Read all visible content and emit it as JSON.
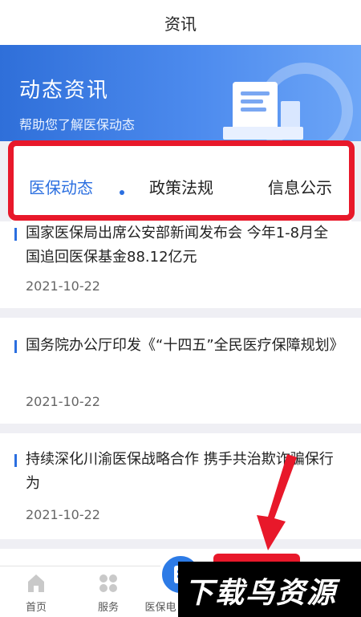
{
  "header": {
    "title": "资讯"
  },
  "hero": {
    "title": "动态资讯",
    "subtitle": "帮助您了解医保动态"
  },
  "tabs": [
    {
      "label": "医保动态",
      "active": true
    },
    {
      "label": "政策法规",
      "active": false
    },
    {
      "label": "信息公示",
      "active": false
    }
  ],
  "news": [
    {
      "headline": "国家医保局出席公安部新闻发布会 今年1-8月全国追回医保基金88.12亿元",
      "date": "2021-10-22"
    },
    {
      "headline": "国务院办公厅印发《“十四五”全民医疗保障规划》",
      "date": "2021-10-22"
    },
    {
      "headline": "持续深化川渝医保战略合作 携手共治欺诈骗保行为",
      "date": "2021-10-22"
    }
  ],
  "bottom_nav": {
    "home": "首页",
    "service": "服务",
    "third": "医保电"
  },
  "watermark": "下载鸟资源",
  "colors": {
    "accent": "#2b6fe0",
    "highlight": "#e8182a"
  }
}
